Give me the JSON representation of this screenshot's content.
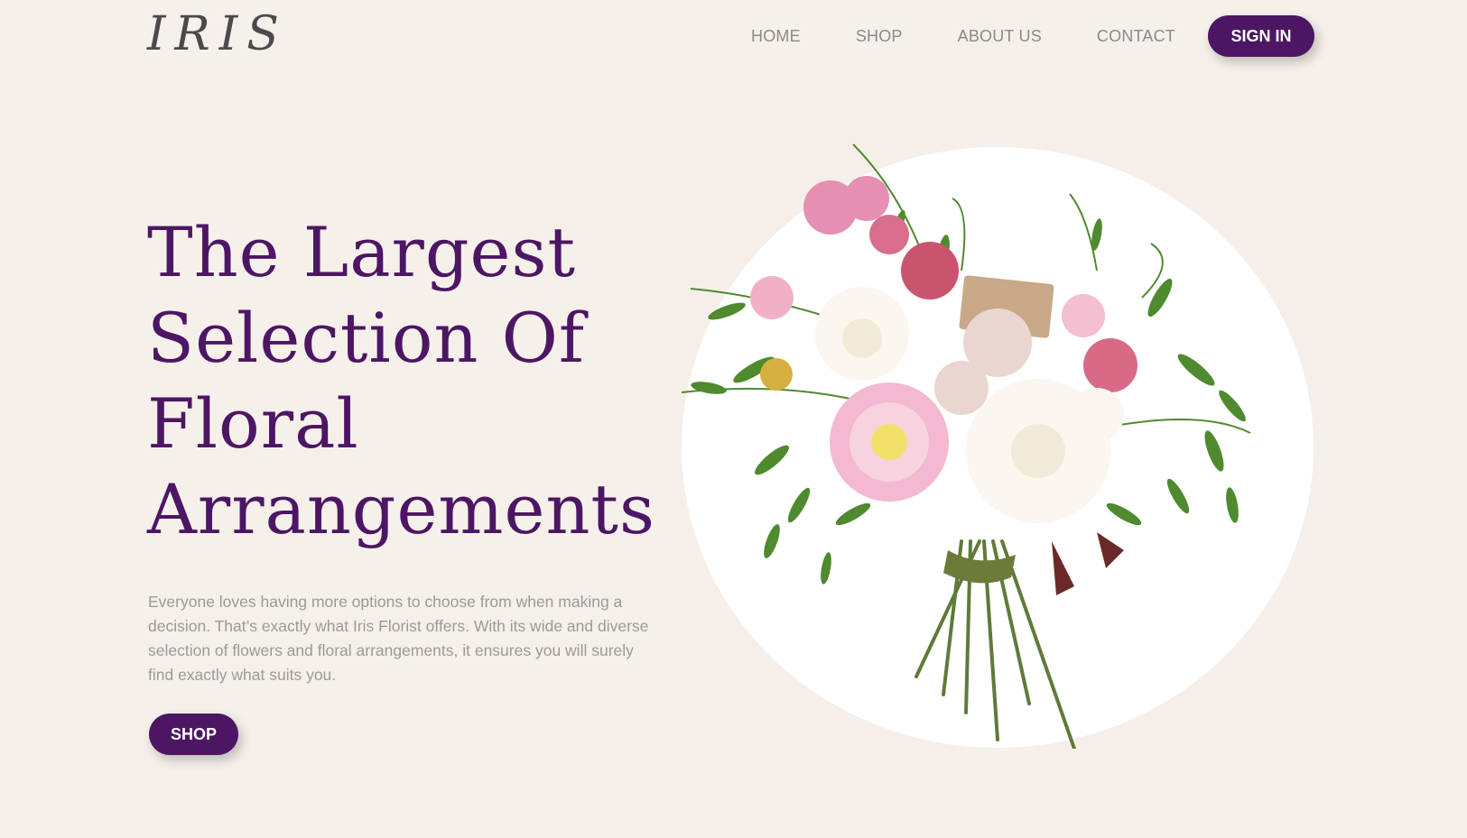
{
  "header": {
    "logo_text": "IRIS",
    "nav": [
      "HOME",
      "SHOP",
      "ABOUT US",
      "CONTACT"
    ],
    "signin_label": "SIGN IN"
  },
  "hero": {
    "headline_lines": [
      "The Largest",
      "Selection Of",
      "Floral",
      "Arrangements"
    ],
    "description": "Everyone loves having more options to choose from when making a decision. That’s exactly what Iris Florist offers. With its wide and diverse selection of flowers and floral arrangements, it ensures you will surely find exactly what suits you.",
    "shop_label": "SHOP"
  },
  "colors": {
    "accent": "#4c1664",
    "background": "#f6f0ea",
    "nav_text": "#8a8a8a",
    "body_text": "#9a9a9a"
  }
}
